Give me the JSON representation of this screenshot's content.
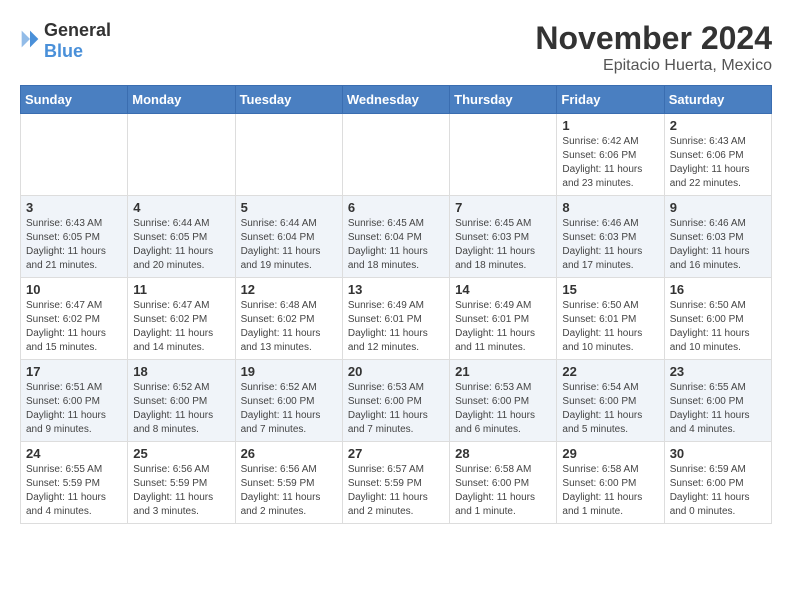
{
  "logo": {
    "general": "General",
    "blue": "Blue"
  },
  "header": {
    "month": "November 2024",
    "location": "Epitacio Huerta, Mexico"
  },
  "weekdays": [
    "Sunday",
    "Monday",
    "Tuesday",
    "Wednesday",
    "Thursday",
    "Friday",
    "Saturday"
  ],
  "weeks": [
    [
      {
        "day": "",
        "info": ""
      },
      {
        "day": "",
        "info": ""
      },
      {
        "day": "",
        "info": ""
      },
      {
        "day": "",
        "info": ""
      },
      {
        "day": "",
        "info": ""
      },
      {
        "day": "1",
        "info": "Sunrise: 6:42 AM\nSunset: 6:06 PM\nDaylight: 11 hours and 23 minutes."
      },
      {
        "day": "2",
        "info": "Sunrise: 6:43 AM\nSunset: 6:06 PM\nDaylight: 11 hours and 22 minutes."
      }
    ],
    [
      {
        "day": "3",
        "info": "Sunrise: 6:43 AM\nSunset: 6:05 PM\nDaylight: 11 hours and 21 minutes."
      },
      {
        "day": "4",
        "info": "Sunrise: 6:44 AM\nSunset: 6:05 PM\nDaylight: 11 hours and 20 minutes."
      },
      {
        "day": "5",
        "info": "Sunrise: 6:44 AM\nSunset: 6:04 PM\nDaylight: 11 hours and 19 minutes."
      },
      {
        "day": "6",
        "info": "Sunrise: 6:45 AM\nSunset: 6:04 PM\nDaylight: 11 hours and 18 minutes."
      },
      {
        "day": "7",
        "info": "Sunrise: 6:45 AM\nSunset: 6:03 PM\nDaylight: 11 hours and 18 minutes."
      },
      {
        "day": "8",
        "info": "Sunrise: 6:46 AM\nSunset: 6:03 PM\nDaylight: 11 hours and 17 minutes."
      },
      {
        "day": "9",
        "info": "Sunrise: 6:46 AM\nSunset: 6:03 PM\nDaylight: 11 hours and 16 minutes."
      }
    ],
    [
      {
        "day": "10",
        "info": "Sunrise: 6:47 AM\nSunset: 6:02 PM\nDaylight: 11 hours and 15 minutes."
      },
      {
        "day": "11",
        "info": "Sunrise: 6:47 AM\nSunset: 6:02 PM\nDaylight: 11 hours and 14 minutes."
      },
      {
        "day": "12",
        "info": "Sunrise: 6:48 AM\nSunset: 6:02 PM\nDaylight: 11 hours and 13 minutes."
      },
      {
        "day": "13",
        "info": "Sunrise: 6:49 AM\nSunset: 6:01 PM\nDaylight: 11 hours and 12 minutes."
      },
      {
        "day": "14",
        "info": "Sunrise: 6:49 AM\nSunset: 6:01 PM\nDaylight: 11 hours and 11 minutes."
      },
      {
        "day": "15",
        "info": "Sunrise: 6:50 AM\nSunset: 6:01 PM\nDaylight: 11 hours and 10 minutes."
      },
      {
        "day": "16",
        "info": "Sunrise: 6:50 AM\nSunset: 6:00 PM\nDaylight: 11 hours and 10 minutes."
      }
    ],
    [
      {
        "day": "17",
        "info": "Sunrise: 6:51 AM\nSunset: 6:00 PM\nDaylight: 11 hours and 9 minutes."
      },
      {
        "day": "18",
        "info": "Sunrise: 6:52 AM\nSunset: 6:00 PM\nDaylight: 11 hours and 8 minutes."
      },
      {
        "day": "19",
        "info": "Sunrise: 6:52 AM\nSunset: 6:00 PM\nDaylight: 11 hours and 7 minutes."
      },
      {
        "day": "20",
        "info": "Sunrise: 6:53 AM\nSunset: 6:00 PM\nDaylight: 11 hours and 7 minutes."
      },
      {
        "day": "21",
        "info": "Sunrise: 6:53 AM\nSunset: 6:00 PM\nDaylight: 11 hours and 6 minutes."
      },
      {
        "day": "22",
        "info": "Sunrise: 6:54 AM\nSunset: 6:00 PM\nDaylight: 11 hours and 5 minutes."
      },
      {
        "day": "23",
        "info": "Sunrise: 6:55 AM\nSunset: 6:00 PM\nDaylight: 11 hours and 4 minutes."
      }
    ],
    [
      {
        "day": "24",
        "info": "Sunrise: 6:55 AM\nSunset: 5:59 PM\nDaylight: 11 hours and 4 minutes."
      },
      {
        "day": "25",
        "info": "Sunrise: 6:56 AM\nSunset: 5:59 PM\nDaylight: 11 hours and 3 minutes."
      },
      {
        "day": "26",
        "info": "Sunrise: 6:56 AM\nSunset: 5:59 PM\nDaylight: 11 hours and 2 minutes."
      },
      {
        "day": "27",
        "info": "Sunrise: 6:57 AM\nSunset: 5:59 PM\nDaylight: 11 hours and 2 minutes."
      },
      {
        "day": "28",
        "info": "Sunrise: 6:58 AM\nSunset: 6:00 PM\nDaylight: 11 hours and 1 minute."
      },
      {
        "day": "29",
        "info": "Sunrise: 6:58 AM\nSunset: 6:00 PM\nDaylight: 11 hours and 1 minute."
      },
      {
        "day": "30",
        "info": "Sunrise: 6:59 AM\nSunset: 6:00 PM\nDaylight: 11 hours and 0 minutes."
      }
    ]
  ]
}
